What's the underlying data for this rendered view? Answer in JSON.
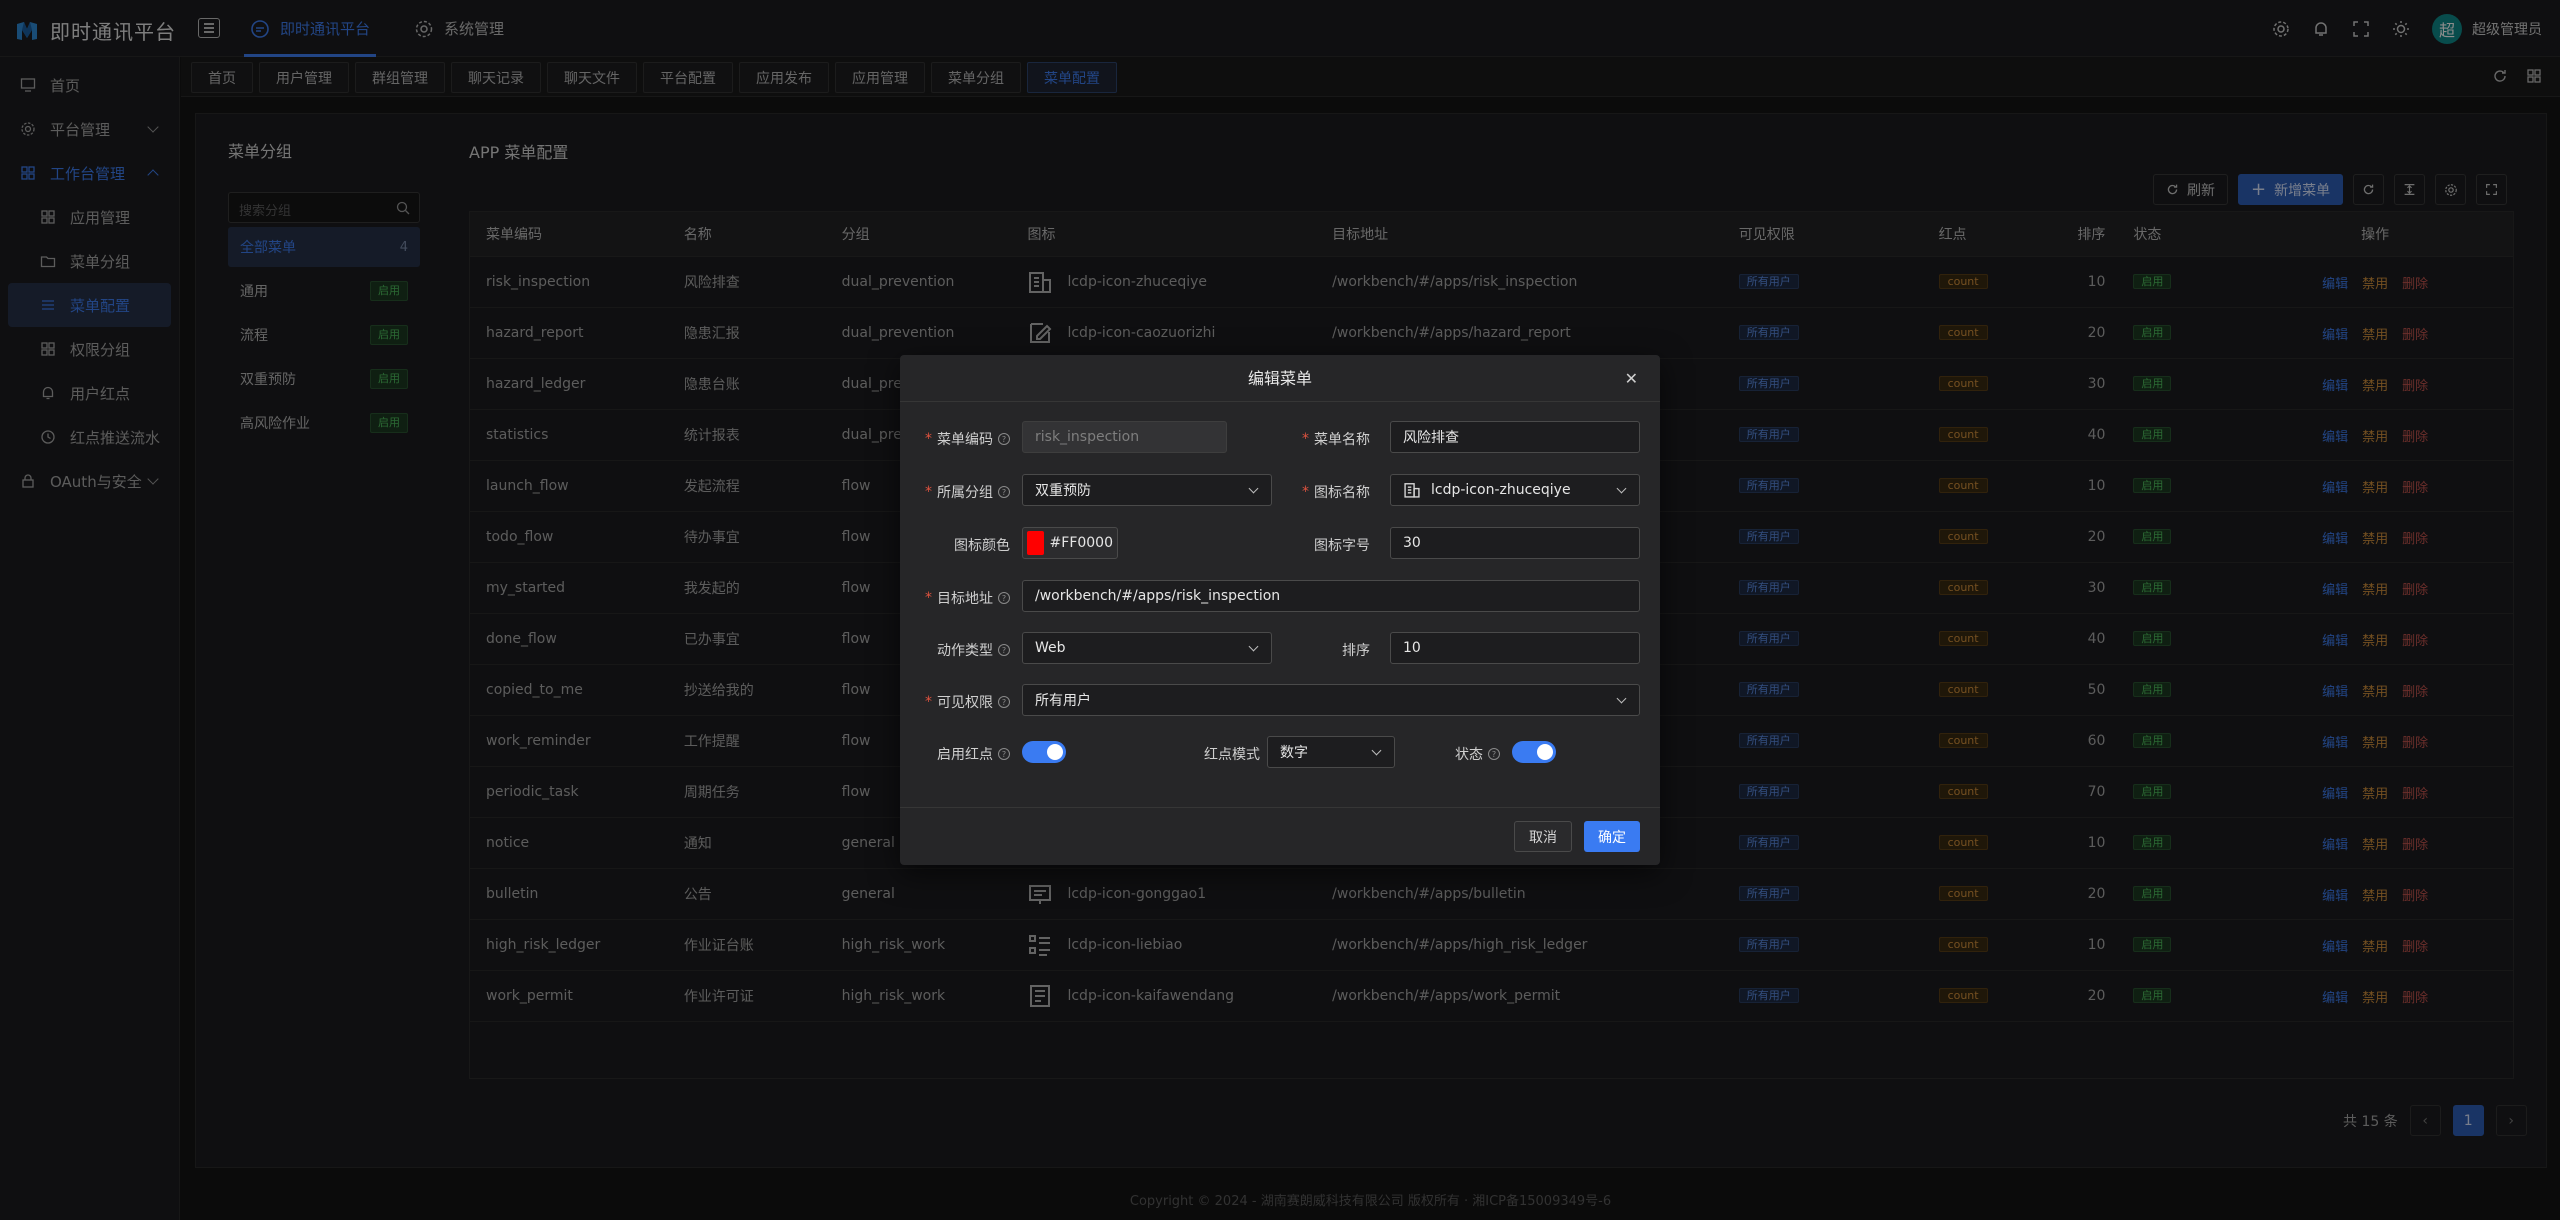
{
  "app": {
    "name": "即时通讯平台"
  },
  "topnav": [
    {
      "label": "即时通讯平台",
      "active": true
    },
    {
      "label": "系统管理",
      "active": false
    }
  ],
  "user": {
    "avatar_char": "超",
    "name": "超级管理员"
  },
  "sidebar": {
    "items": [
      {
        "label": "首页",
        "icon": "monitor-icon"
      },
      {
        "label": "平台管理",
        "icon": "gear-icon"
      },
      {
        "label": "工作台管理",
        "icon": "grid-icon"
      },
      {
        "label": "应用管理",
        "icon": "apps-icon"
      },
      {
        "label": "菜单分组",
        "icon": "folder-icon"
      },
      {
        "label": "菜单配置",
        "icon": "list-icon"
      },
      {
        "label": "权限分组",
        "icon": "grid-icon"
      },
      {
        "label": "用户红点",
        "icon": "bell-icon"
      },
      {
        "label": "红点推送流水",
        "icon": "clock-icon"
      },
      {
        "label": "OAuth与安全",
        "icon": "lock-icon"
      }
    ]
  },
  "tabs": [
    "首页",
    "用户管理",
    "群组管理",
    "聊天记录",
    "聊天文件",
    "平台配置",
    "应用发布",
    "应用管理",
    "菜单分组",
    "菜单配置"
  ],
  "group_panel": {
    "title": "菜单分组",
    "search_placeholder": "搜索分组",
    "groups": [
      {
        "label": "全部菜单",
        "count": "4"
      },
      {
        "label": "通用",
        "tag": "启用"
      },
      {
        "label": "流程",
        "tag": "启用"
      },
      {
        "label": "双重预防",
        "tag": "启用"
      },
      {
        "label": "高风险作业",
        "tag": "启用"
      }
    ]
  },
  "config": {
    "title": "APP 菜单配置",
    "refresh_label": "刷新",
    "add_label": "新增菜单"
  },
  "table": {
    "headers": [
      "菜单编码",
      "名称",
      "分组",
      "图标",
      "目标地址",
      "可见权限",
      "红点",
      "排序",
      "状态",
      "操作"
    ],
    "rows": [
      {
        "code": "risk_inspection",
        "name": "风险排查",
        "group": "dual_prevention",
        "icon": "lcdp-icon-zhuceqiye",
        "target": "/workbench/#/apps/risk_inspection",
        "perm": "所有用户",
        "dot": "count",
        "sort": "10",
        "status": "启用"
      },
      {
        "code": "hazard_report",
        "name": "隐患汇报",
        "group": "dual_prevention",
        "icon": "lcdp-icon-caozuorizhi",
        "target": "/workbench/#/apps/hazard_report",
        "perm": "所有用户",
        "dot": "count",
        "sort": "20",
        "status": "启用"
      },
      {
        "code": "hazard_ledger",
        "name": "隐患台账",
        "group": "dual_pre",
        "icon": "",
        "target": "",
        "perm": "所有用户",
        "dot": "count",
        "sort": "30",
        "status": "启用"
      },
      {
        "code": "statistics",
        "name": "统计报表",
        "group": "dual_pre",
        "icon": "",
        "target": "",
        "perm": "所有用户",
        "dot": "count",
        "sort": "40",
        "status": "启用"
      },
      {
        "code": "launch_flow",
        "name": "发起流程",
        "group": "flow",
        "icon": "",
        "target": "",
        "perm": "所有用户",
        "dot": "count",
        "sort": "10",
        "status": "启用"
      },
      {
        "code": "todo_flow",
        "name": "待办事宜",
        "group": "flow",
        "icon": "",
        "target": "",
        "perm": "所有用户",
        "dot": "count",
        "sort": "20",
        "status": "启用"
      },
      {
        "code": "my_started",
        "name": "我发起的",
        "group": "flow",
        "icon": "",
        "target": "",
        "perm": "所有用户",
        "dot": "count",
        "sort": "30",
        "status": "启用"
      },
      {
        "code": "done_flow",
        "name": "已办事宜",
        "group": "flow",
        "icon": "",
        "target": "",
        "perm": "所有用户",
        "dot": "count",
        "sort": "40",
        "status": "启用"
      },
      {
        "code": "copied_to_me",
        "name": "抄送给我的",
        "group": "flow",
        "icon": "",
        "target": "",
        "perm": "所有用户",
        "dot": "count",
        "sort": "50",
        "status": "启用"
      },
      {
        "code": "work_reminder",
        "name": "工作提醒",
        "group": "flow",
        "icon": "",
        "target": "",
        "perm": "所有用户",
        "dot": "count",
        "sort": "60",
        "status": "启用"
      },
      {
        "code": "periodic_task",
        "name": "周期任务",
        "group": "flow",
        "icon": "",
        "target": "",
        "perm": "所有用户",
        "dot": "count",
        "sort": "70",
        "status": "启用"
      },
      {
        "code": "notice",
        "name": "通知",
        "group": "general",
        "icon": "",
        "target": "",
        "perm": "所有用户",
        "dot": "count",
        "sort": "10",
        "status": "启用"
      },
      {
        "code": "bulletin",
        "name": "公告",
        "group": "general",
        "icon": "lcdp-icon-gonggao1",
        "target": "/workbench/#/apps/bulletin",
        "perm": "所有用户",
        "dot": "count",
        "sort": "20",
        "status": "启用"
      },
      {
        "code": "high_risk_ledger",
        "name": "作业证台账",
        "group": "high_risk_work",
        "icon": "lcdp-icon-liebiao",
        "target": "/workbench/#/apps/high_risk_ledger",
        "perm": "所有用户",
        "dot": "count",
        "sort": "10",
        "status": "启用"
      },
      {
        "code": "work_permit",
        "name": "作业许可证",
        "group": "high_risk_work",
        "icon": "lcdp-icon-kaifawendang",
        "target": "/workbench/#/apps/work_permit",
        "perm": "所有用户",
        "dot": "count",
        "sort": "20",
        "status": "启用"
      }
    ],
    "actions": {
      "edit": "编辑",
      "disable": "禁用",
      "delete": "删除"
    }
  },
  "pager": {
    "total": "共 15 条",
    "page": "1"
  },
  "footer": "Copyright © 2024 - 湖南赛朗威科技有限公司 版权所有 · 湘ICP备15009349号-6",
  "modal": {
    "title": "编辑菜单",
    "fields": {
      "code_label": "菜单编码",
      "code_value": "risk_inspection",
      "name_label": "菜单名称",
      "name_value": "风险排查",
      "group_label": "所属分组",
      "group_value": "双重预防",
      "icon_label": "图标名称",
      "icon_value": "lcdp-icon-zhuceqiye",
      "color_label": "图标颜色",
      "color_value": "#FF0000",
      "size_label": "图标字号",
      "size_value": "30",
      "target_label": "目标地址",
      "target_value": "/workbench/#/apps/risk_inspection",
      "action_label": "动作类型",
      "action_value": "Web",
      "sort_label": "排序",
      "sort_value": "10",
      "perm_label": "可见权限",
      "perm_value": "所有用户",
      "dot_enable_label": "启用红点",
      "dot_mode_label": "红点模式",
      "dot_mode_value": "数字",
      "status_label": "状态"
    },
    "cancel": "取消",
    "ok": "确定"
  },
  "colors": {
    "accent": "#3f7ef2",
    "swatch": "#FF0000"
  }
}
